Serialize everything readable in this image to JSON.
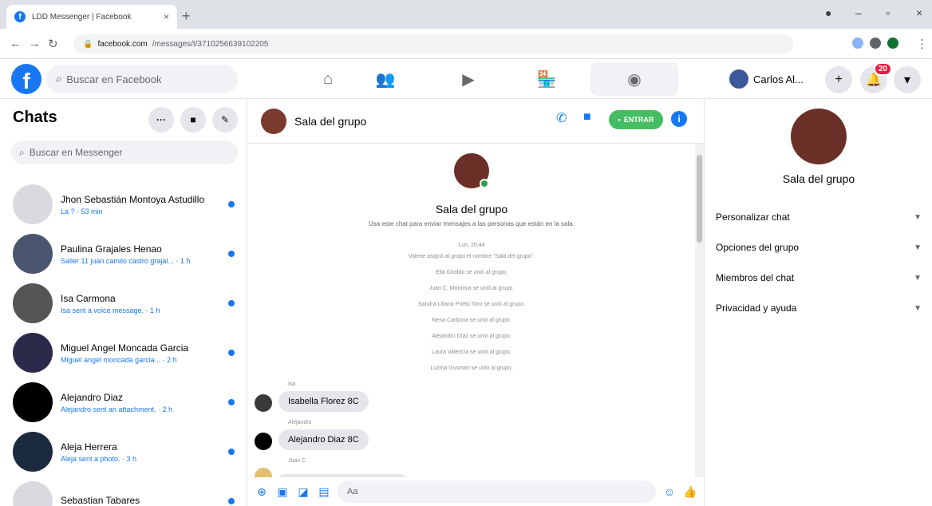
{
  "browser": {
    "tab_title": "LDD Messenger | Facebook",
    "tab_close": "×",
    "new_tab": "+",
    "url_host": "facebook.com",
    "url_path": "/messages/t/3710256639102205",
    "window_controls": [
      "–",
      "▫",
      "×"
    ]
  },
  "fb_nav": {
    "search_placeholder": "Buscar en Facebook",
    "profile_name": "Carlos Al...",
    "notifications_count": "20",
    "plus_label": "+",
    "menu_label": "▾"
  },
  "sidebar": {
    "title": "Chats",
    "search_placeholder": "Buscar en Messenger",
    "chats": [
      {
        "name": "Jhon Sebastián Montoya Astudillo",
        "snippet": "La ? · 53 min"
      },
      {
        "name": "Paulina Grajales Henao",
        "snippet": "Saller 11 juan camilo castro grajal... · 1 h"
      },
      {
        "name": "Isa Carmona",
        "snippet": "Isa sent a voice message. · 1 h"
      },
      {
        "name": "Miguel Angel Moncada Garcia",
        "snippet": "Miguel angel moncada garcia... · 2 h"
      },
      {
        "name": "Alejandro Diaz",
        "snippet": "Alejandro sent an attachment. · 2 h"
      },
      {
        "name": "Aleja Herrera",
        "snippet": "Aleja sent a photo. · 3 h"
      },
      {
        "name": "Sebastian Tabares",
        "snippet": ""
      }
    ]
  },
  "conversation": {
    "title": "Sala del grupo",
    "join_label": "ENTRAR",
    "group_name": "Sala del grupo",
    "group_description": "Usa este chat para enviar mensajes a las personas que están en la sala.",
    "system_lines": [
      "Lun, 20:44",
      "Valerie asignó al grupo el nombre \"Sala del grupo\".",
      "Ella Giraldo se unió al grupo.",
      "Juan C. Montoya se unió al grupo.",
      "Sandra Liliana Prieto Toro se unió al grupo.",
      "Nena Carbona se unió al grupo.",
      "Alejandro Díaz se unió al grupo.",
      "Laura Valencia se unió al grupo.",
      "Luzma Gusman se unió al grupo."
    ],
    "messages": [
      {
        "sender": "Isa",
        "text": "Isabella Florez 8C"
      },
      {
        "sender": "Alejandro",
        "text": "Alejandro Diaz 8C"
      },
      {
        "sender": "Juan C.",
        "text": ""
      }
    ],
    "composer_placeholder": "Aa"
  },
  "info_panel": {
    "name": "Sala del grupo",
    "sections": [
      "Personalizar chat",
      "Opciones del grupo",
      "Miembros del chat",
      "Privacidad y ayuda"
    ]
  },
  "colors": {
    "accent": "#1877f2",
    "join_green": "#45bd62",
    "badge_red": "#e41e3f"
  }
}
